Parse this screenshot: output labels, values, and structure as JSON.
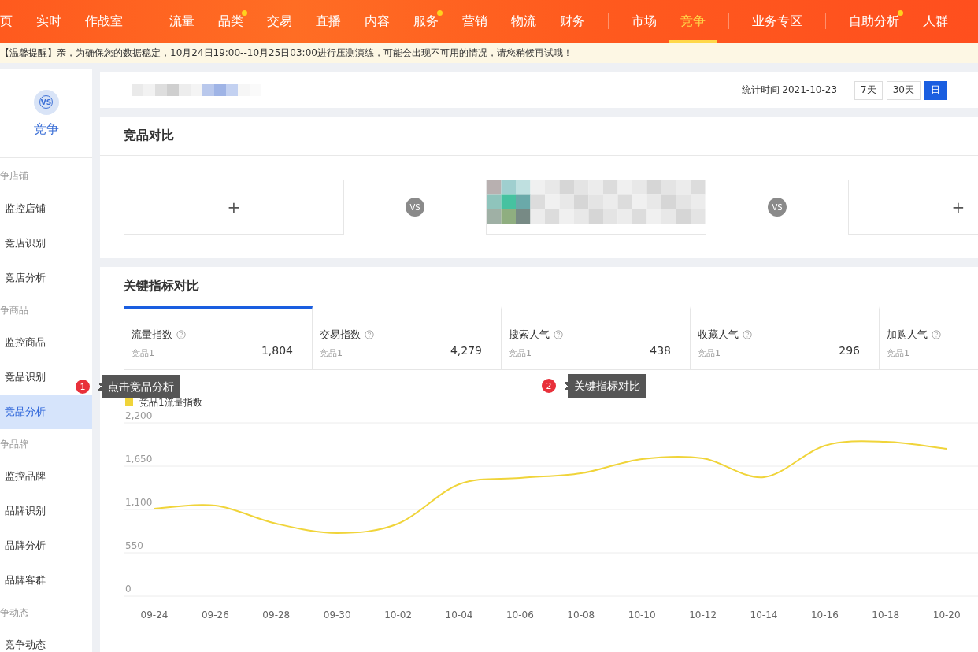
{
  "nav": {
    "groups": [
      [
        {
          "label": "页",
          "selected": false,
          "dot": false
        },
        {
          "label": "实时",
          "selected": false,
          "dot": false
        },
        {
          "label": "作战室",
          "selected": false,
          "dot": false
        }
      ],
      [
        {
          "label": "流量",
          "selected": false,
          "dot": false
        },
        {
          "label": "品类",
          "selected": false,
          "dot": true
        },
        {
          "label": "交易",
          "selected": false,
          "dot": false
        },
        {
          "label": "直播",
          "selected": false,
          "dot": false
        },
        {
          "label": "内容",
          "selected": false,
          "dot": false
        },
        {
          "label": "服务",
          "selected": false,
          "dot": true
        },
        {
          "label": "营销",
          "selected": false,
          "dot": false
        },
        {
          "label": "物流",
          "selected": false,
          "dot": false
        },
        {
          "label": "财务",
          "selected": false,
          "dot": false
        }
      ],
      [
        {
          "label": "市场",
          "selected": false,
          "dot": false
        },
        {
          "label": "竞争",
          "selected": true,
          "dot": false
        }
      ],
      [
        {
          "label": "业务专区",
          "selected": false,
          "dot": false
        }
      ],
      [
        {
          "label": "自助分析",
          "selected": false,
          "dot": true
        },
        {
          "label": "人群",
          "selected": false,
          "dot": false
        }
      ]
    ]
  },
  "notice": "【温馨提醒】亲，为确保您的数据稳定，10月24日19:00--10月25日03:00进行压测演练，可能会出现不可用的情况，请您稍候再试哦！",
  "sidebar": {
    "icon_label": "VS",
    "title": "竞争",
    "groups": [
      {
        "label": "争店铺",
        "items": [
          {
            "label": "监控店铺",
            "selected": false
          },
          {
            "label": "竞店识别",
            "selected": false
          },
          {
            "label": "竞店分析",
            "selected": false
          }
        ]
      },
      {
        "label": "争商品",
        "items": [
          {
            "label": "监控商品",
            "selected": false
          },
          {
            "label": "竞品识别",
            "selected": false
          },
          {
            "label": "竞品分析",
            "selected": true
          }
        ]
      },
      {
        "label": "争品牌",
        "items": [
          {
            "label": "监控品牌",
            "selected": false
          },
          {
            "label": "品牌识别",
            "selected": false
          },
          {
            "label": "品牌分析",
            "selected": false
          },
          {
            "label": "品牌客群",
            "selected": false
          }
        ]
      },
      {
        "label": "争动态",
        "items": [
          {
            "label": "竞争动态",
            "selected": false
          }
        ]
      }
    ]
  },
  "header": {
    "stat_time": "统计时间 2021-10-23",
    "ranges": [
      {
        "label": "7天",
        "selected": false
      },
      {
        "label": "30天",
        "selected": false
      },
      {
        "label": "日",
        "selected": true
      }
    ]
  },
  "compare": {
    "title": "竞品对比",
    "slots": [
      {
        "kind": "add",
        "label": "+"
      },
      {
        "kind": "vs",
        "label": "VS"
      },
      {
        "kind": "product"
      },
      {
        "kind": "vs",
        "label": "VS"
      },
      {
        "kind": "add",
        "label": "+"
      }
    ]
  },
  "metrics": {
    "title": "关键指标对比",
    "tabs": [
      {
        "label": "流量指数",
        "sub": "竞品1",
        "value": "1,804",
        "selected": true
      },
      {
        "label": "交易指数",
        "sub": "竞品1",
        "value": "4,279",
        "selected": false
      },
      {
        "label": "搜索人气",
        "sub": "竞品1",
        "value": "438",
        "selected": false
      },
      {
        "label": "收藏人气",
        "sub": "竞品1",
        "value": "296",
        "selected": false
      },
      {
        "label": "加购人气",
        "sub": "竞品1",
        "selected": false
      }
    ],
    "chart_data": {
      "type": "line",
      "grid": true,
      "categories": [
        "09-24",
        "09-26",
        "09-28",
        "09-30",
        "10-02",
        "10-04",
        "10-06",
        "10-08",
        "10-10",
        "10-12",
        "10-14",
        "10-16",
        "10-18",
        "10-20"
      ],
      "series": [
        {
          "name": "竞品1流量指数",
          "color": "#f0d43a",
          "values": [
            1110,
            1150,
            920,
            800,
            920,
            1420,
            1500,
            1560,
            1740,
            1750,
            1510,
            1910,
            1960,
            1870
          ]
        }
      ],
      "ylim": [
        0,
        2200
      ],
      "yticks": [
        {
          "value": 0,
          "label": "0"
        },
        {
          "value": 550,
          "label": "550"
        },
        {
          "value": 1100,
          "label": "1,100"
        },
        {
          "value": 1650,
          "label": "1,650"
        },
        {
          "value": 2200,
          "label": "2,200"
        }
      ]
    }
  },
  "guides": [
    {
      "number": "1",
      "text": "点击竞品分析"
    },
    {
      "number": "2",
      "text": "关键指标对比"
    }
  ]
}
